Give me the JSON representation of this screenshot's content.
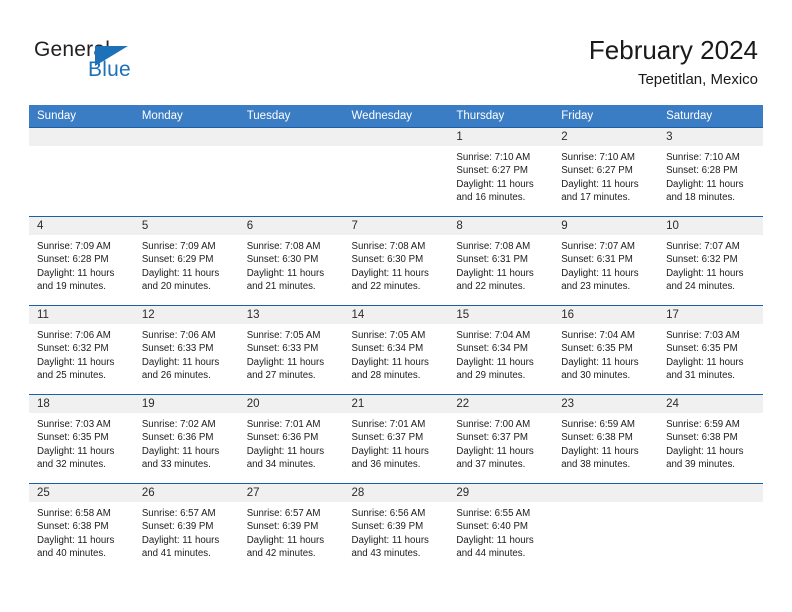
{
  "brand": {
    "name_top": "General",
    "name_bottom": "Blue",
    "accent_color": "#1d71b8"
  },
  "header": {
    "title": "February 2024",
    "subtitle": "Tepetitlan, Mexico",
    "header_bg_color": "#3b7dc4",
    "row_line_color": "#1b5ea8",
    "daynum_bg_color": "#f0f0f0"
  },
  "weekday_headers": [
    "Sunday",
    "Monday",
    "Tuesday",
    "Wednesday",
    "Thursday",
    "Friday",
    "Saturday"
  ],
  "weeks": [
    [
      {
        "day": "",
        "empty": true
      },
      {
        "day": "",
        "empty": true
      },
      {
        "day": "",
        "empty": true
      },
      {
        "day": "",
        "empty": true
      },
      {
        "day": "1",
        "sunrise": "Sunrise: 7:10 AM",
        "sunset": "Sunset: 6:27 PM",
        "daylight_1": "Daylight: 11 hours",
        "daylight_2": "and 16 minutes."
      },
      {
        "day": "2",
        "sunrise": "Sunrise: 7:10 AM",
        "sunset": "Sunset: 6:27 PM",
        "daylight_1": "Daylight: 11 hours",
        "daylight_2": "and 17 minutes."
      },
      {
        "day": "3",
        "sunrise": "Sunrise: 7:10 AM",
        "sunset": "Sunset: 6:28 PM",
        "daylight_1": "Daylight: 11 hours",
        "daylight_2": "and 18 minutes."
      }
    ],
    [
      {
        "day": "4",
        "sunrise": "Sunrise: 7:09 AM",
        "sunset": "Sunset: 6:28 PM",
        "daylight_1": "Daylight: 11 hours",
        "daylight_2": "and 19 minutes."
      },
      {
        "day": "5",
        "sunrise": "Sunrise: 7:09 AM",
        "sunset": "Sunset: 6:29 PM",
        "daylight_1": "Daylight: 11 hours",
        "daylight_2": "and 20 minutes."
      },
      {
        "day": "6",
        "sunrise": "Sunrise: 7:08 AM",
        "sunset": "Sunset: 6:30 PM",
        "daylight_1": "Daylight: 11 hours",
        "daylight_2": "and 21 minutes."
      },
      {
        "day": "7",
        "sunrise": "Sunrise: 7:08 AM",
        "sunset": "Sunset: 6:30 PM",
        "daylight_1": "Daylight: 11 hours",
        "daylight_2": "and 22 minutes."
      },
      {
        "day": "8",
        "sunrise": "Sunrise: 7:08 AM",
        "sunset": "Sunset: 6:31 PM",
        "daylight_1": "Daylight: 11 hours",
        "daylight_2": "and 22 minutes."
      },
      {
        "day": "9",
        "sunrise": "Sunrise: 7:07 AM",
        "sunset": "Sunset: 6:31 PM",
        "daylight_1": "Daylight: 11 hours",
        "daylight_2": "and 23 minutes."
      },
      {
        "day": "10",
        "sunrise": "Sunrise: 7:07 AM",
        "sunset": "Sunset: 6:32 PM",
        "daylight_1": "Daylight: 11 hours",
        "daylight_2": "and 24 minutes."
      }
    ],
    [
      {
        "day": "11",
        "sunrise": "Sunrise: 7:06 AM",
        "sunset": "Sunset: 6:32 PM",
        "daylight_1": "Daylight: 11 hours",
        "daylight_2": "and 25 minutes."
      },
      {
        "day": "12",
        "sunrise": "Sunrise: 7:06 AM",
        "sunset": "Sunset: 6:33 PM",
        "daylight_1": "Daylight: 11 hours",
        "daylight_2": "and 26 minutes."
      },
      {
        "day": "13",
        "sunrise": "Sunrise: 7:05 AM",
        "sunset": "Sunset: 6:33 PM",
        "daylight_1": "Daylight: 11 hours",
        "daylight_2": "and 27 minutes."
      },
      {
        "day": "14",
        "sunrise": "Sunrise: 7:05 AM",
        "sunset": "Sunset: 6:34 PM",
        "daylight_1": "Daylight: 11 hours",
        "daylight_2": "and 28 minutes."
      },
      {
        "day": "15",
        "sunrise": "Sunrise: 7:04 AM",
        "sunset": "Sunset: 6:34 PM",
        "daylight_1": "Daylight: 11 hours",
        "daylight_2": "and 29 minutes."
      },
      {
        "day": "16",
        "sunrise": "Sunrise: 7:04 AM",
        "sunset": "Sunset: 6:35 PM",
        "daylight_1": "Daylight: 11 hours",
        "daylight_2": "and 30 minutes."
      },
      {
        "day": "17",
        "sunrise": "Sunrise: 7:03 AM",
        "sunset": "Sunset: 6:35 PM",
        "daylight_1": "Daylight: 11 hours",
        "daylight_2": "and 31 minutes."
      }
    ],
    [
      {
        "day": "18",
        "sunrise": "Sunrise: 7:03 AM",
        "sunset": "Sunset: 6:35 PM",
        "daylight_1": "Daylight: 11 hours",
        "daylight_2": "and 32 minutes."
      },
      {
        "day": "19",
        "sunrise": "Sunrise: 7:02 AM",
        "sunset": "Sunset: 6:36 PM",
        "daylight_1": "Daylight: 11 hours",
        "daylight_2": "and 33 minutes."
      },
      {
        "day": "20",
        "sunrise": "Sunrise: 7:01 AM",
        "sunset": "Sunset: 6:36 PM",
        "daylight_1": "Daylight: 11 hours",
        "daylight_2": "and 34 minutes."
      },
      {
        "day": "21",
        "sunrise": "Sunrise: 7:01 AM",
        "sunset": "Sunset: 6:37 PM",
        "daylight_1": "Daylight: 11 hours",
        "daylight_2": "and 36 minutes."
      },
      {
        "day": "22",
        "sunrise": "Sunrise: 7:00 AM",
        "sunset": "Sunset: 6:37 PM",
        "daylight_1": "Daylight: 11 hours",
        "daylight_2": "and 37 minutes."
      },
      {
        "day": "23",
        "sunrise": "Sunrise: 6:59 AM",
        "sunset": "Sunset: 6:38 PM",
        "daylight_1": "Daylight: 11 hours",
        "daylight_2": "and 38 minutes."
      },
      {
        "day": "24",
        "sunrise": "Sunrise: 6:59 AM",
        "sunset": "Sunset: 6:38 PM",
        "daylight_1": "Daylight: 11 hours",
        "daylight_2": "and 39 minutes."
      }
    ],
    [
      {
        "day": "25",
        "sunrise": "Sunrise: 6:58 AM",
        "sunset": "Sunset: 6:38 PM",
        "daylight_1": "Daylight: 11 hours",
        "daylight_2": "and 40 minutes."
      },
      {
        "day": "26",
        "sunrise": "Sunrise: 6:57 AM",
        "sunset": "Sunset: 6:39 PM",
        "daylight_1": "Daylight: 11 hours",
        "daylight_2": "and 41 minutes."
      },
      {
        "day": "27",
        "sunrise": "Sunrise: 6:57 AM",
        "sunset": "Sunset: 6:39 PM",
        "daylight_1": "Daylight: 11 hours",
        "daylight_2": "and 42 minutes."
      },
      {
        "day": "28",
        "sunrise": "Sunrise: 6:56 AM",
        "sunset": "Sunset: 6:39 PM",
        "daylight_1": "Daylight: 11 hours",
        "daylight_2": "and 43 minutes."
      },
      {
        "day": "29",
        "sunrise": "Sunrise: 6:55 AM",
        "sunset": "Sunset: 6:40 PM",
        "daylight_1": "Daylight: 11 hours",
        "daylight_2": "and 44 minutes."
      },
      {
        "day": "",
        "empty": true
      },
      {
        "day": "",
        "empty": true
      }
    ]
  ]
}
